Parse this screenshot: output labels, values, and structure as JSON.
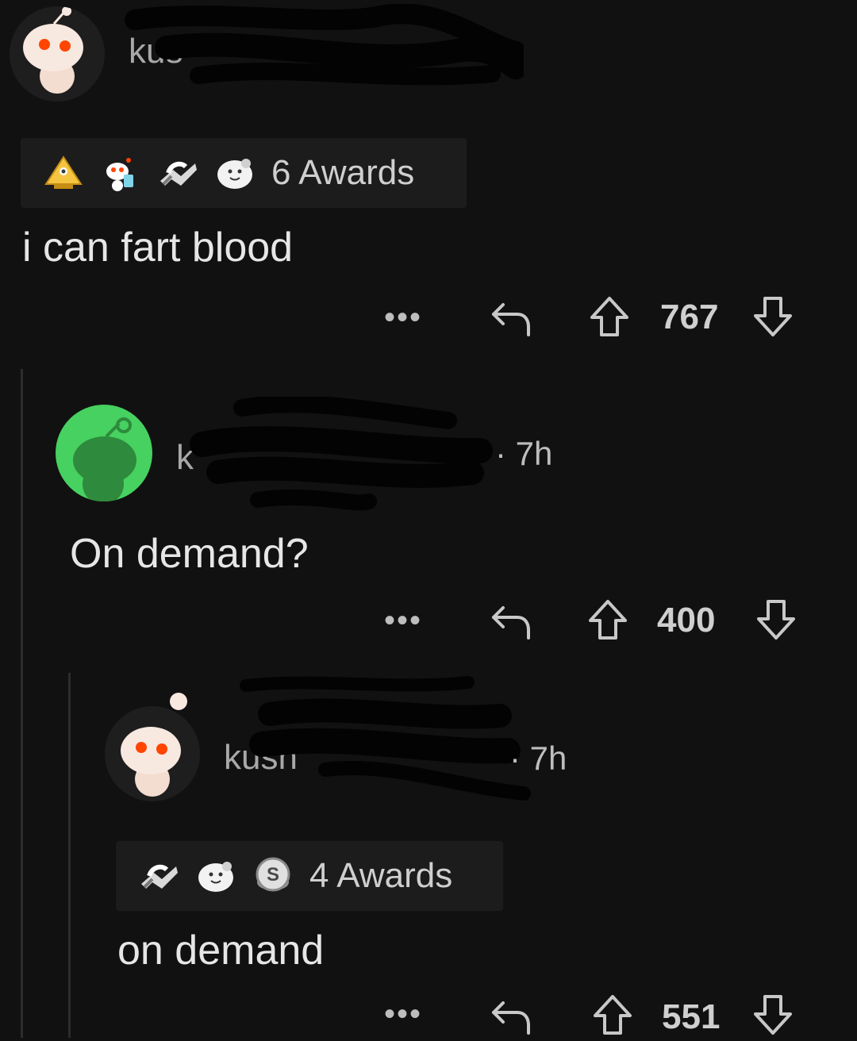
{
  "comments": [
    {
      "username": "kus",
      "time": "",
      "awards_label": "6 Awards",
      "award_icons": [
        "pyramid-award-icon",
        "snoo-drinking-award-icon",
        "handshake-award-icon",
        "wholesome-seal-award-icon"
      ],
      "body": "i can fart blood",
      "more_label": "•••",
      "score": "767"
    },
    {
      "username": "k",
      "time": "· 7h",
      "body": "On demand?",
      "more_label": "•••",
      "score": "400"
    },
    {
      "username": "kusn",
      "time": "· 7h",
      "awards_label": "4 Awards",
      "award_icons": [
        "handshake-award-icon",
        "wholesome-seal-award-icon",
        "silver-coin-award-icon"
      ],
      "body": "on demand",
      "more_label": "•••",
      "score": "551"
    }
  ],
  "colors": {
    "background": "#111111",
    "avatar_green": "#46d160",
    "snoo_eye": "#ff4500"
  }
}
